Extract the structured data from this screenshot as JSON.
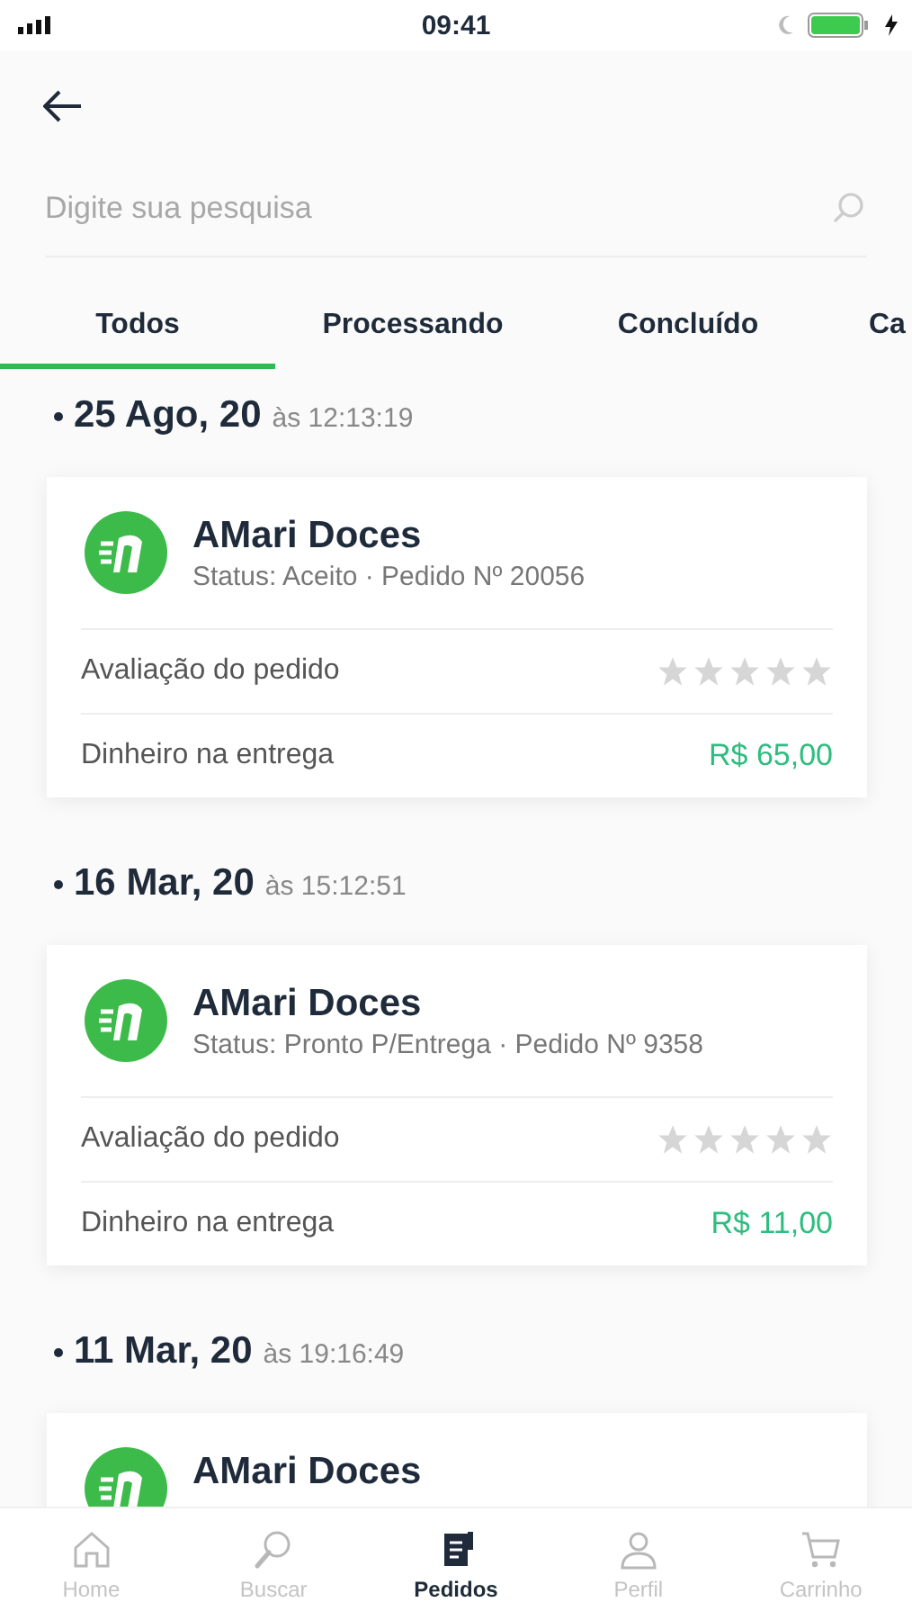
{
  "status_bar": {
    "time": "09:41"
  },
  "search": {
    "placeholder": "Digite sua pesquisa"
  },
  "tabs": [
    {
      "label": "Todos",
      "selected": true
    },
    {
      "label": "Processando",
      "selected": false
    },
    {
      "label": "Concluído",
      "selected": false
    },
    {
      "label": "Ca",
      "selected": false
    }
  ],
  "orders": [
    {
      "date": "25 Ago, 20",
      "time_prefix": "às",
      "time": "12:13:19",
      "store": "AMari Doces",
      "status": "Status: Aceito · Pedido Nº 20056",
      "rating_label": "Avaliação do pedido",
      "stars": 0,
      "payment": "Dinheiro na entrega",
      "total": "R$ 65,00"
    },
    {
      "date": "16 Mar, 20",
      "time_prefix": "às",
      "time": "15:12:51",
      "store": "AMari Doces",
      "status": "Status: Pronto P/Entrega · Pedido Nº 9358",
      "rating_label": "Avaliação do pedido",
      "stars": 0,
      "payment": "Dinheiro na entrega",
      "total": "R$ 11,00"
    },
    {
      "date": "11 Mar, 20",
      "time_prefix": "às",
      "time": "19:16:49",
      "store": "AMari Doces"
    }
  ],
  "bottom_nav": [
    {
      "kind": "home",
      "label": "Home",
      "selected": false
    },
    {
      "kind": "search",
      "label": "Buscar",
      "selected": false
    },
    {
      "kind": "orders",
      "label": "Pedidos",
      "selected": true
    },
    {
      "kind": "profile",
      "label": "Perfil",
      "selected": false
    },
    {
      "kind": "cart",
      "label": "Carrinho",
      "selected": false
    }
  ]
}
